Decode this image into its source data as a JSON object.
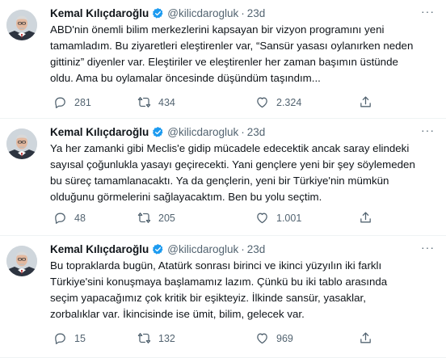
{
  "tweets": [
    {
      "name": "Kemal Kılıçdaroğlu",
      "handle": "@kilicdarogluk",
      "separator": "·",
      "time": "23d",
      "lines": [
        "ABD'nin önemli bilim merkezlerini kapsayan bir vizyon programını yeni",
        "tamamladım. Bu ziyaretleri eleştirenler var, “Sansür yasası oylanırken neden",
        "gittiniz” diyenler var. Eleştiriler ve eleştirenler her zaman başımın üstünde",
        "oldu. Ama bu oylamalar öncesinde düşündüm taşındım..."
      ],
      "replies": "281",
      "retweets": "434",
      "likes": "2.324"
    },
    {
      "name": "Kemal Kılıçdaroğlu",
      "handle": "@kilicdarogluk",
      "separator": "·",
      "time": "23d",
      "lines": [
        "Ya her zamanki gibi Meclis'e gidip mücadele edecektik ancak saray elindeki",
        "sayısal çoğunlukla yasayı geçirecekti. Yani gençlere yeni bir şey söylemeden",
        "bu süreç tamamlanacaktı. Ya da gençlerin, yeni bir Türkiye'nin mümkün",
        "olduğunu görmelerini sağlayacaktım. Ben bu yolu seçtim."
      ],
      "replies": "48",
      "retweets": "205",
      "likes": "1.001"
    },
    {
      "name": "Kemal Kılıçdaroğlu",
      "handle": "@kilicdarogluk",
      "separator": "·",
      "time": "23d",
      "lines": [
        "Bu topraklarda bugün, Atatürk sonrası birinci ve ikinci yüzyılın iki farklı",
        "Türkiye'sini konuşmaya başlamamız lazım. Çünkü bu iki tablo arasında",
        "seçim yapacağımız çok kritik bir eşikteyiz. İlkinde sansür, yasaklar,",
        "zorbalıklar var. İkincisinde ise ümit, bilim, gelecek var."
      ],
      "replies": "15",
      "retweets": "132",
      "likes": "969"
    }
  ],
  "more_label": "···",
  "colors": {
    "verified": "#1d9bf0",
    "muted": "#536471",
    "text": "#0f1419"
  },
  "icons": [
    "reply-icon",
    "retweet-icon",
    "like-icon",
    "share-icon",
    "verified-badge-icon",
    "more-icon"
  ]
}
